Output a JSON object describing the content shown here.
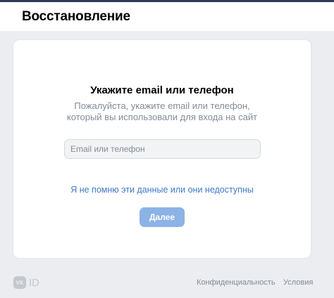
{
  "header": {
    "title": "Восстановление"
  },
  "card": {
    "title": "Укажите email или телефон",
    "subtitle": "Пожалуйста, укажите email или телефон, который вы использовали для входа на сайт",
    "input": {
      "placeholder": "Email или телефон",
      "value": ""
    },
    "forgot_link": "Я не помню эти данные или они недоступны",
    "next_button": "Далее"
  },
  "footer": {
    "logo_vk": "VK",
    "logo_id": "ID",
    "privacy": "Конфиденциальность",
    "terms": "Условия"
  },
  "colors": {
    "link": "#3f7ac7",
    "button": "#8cb3e6",
    "background": "#ebedf0"
  }
}
